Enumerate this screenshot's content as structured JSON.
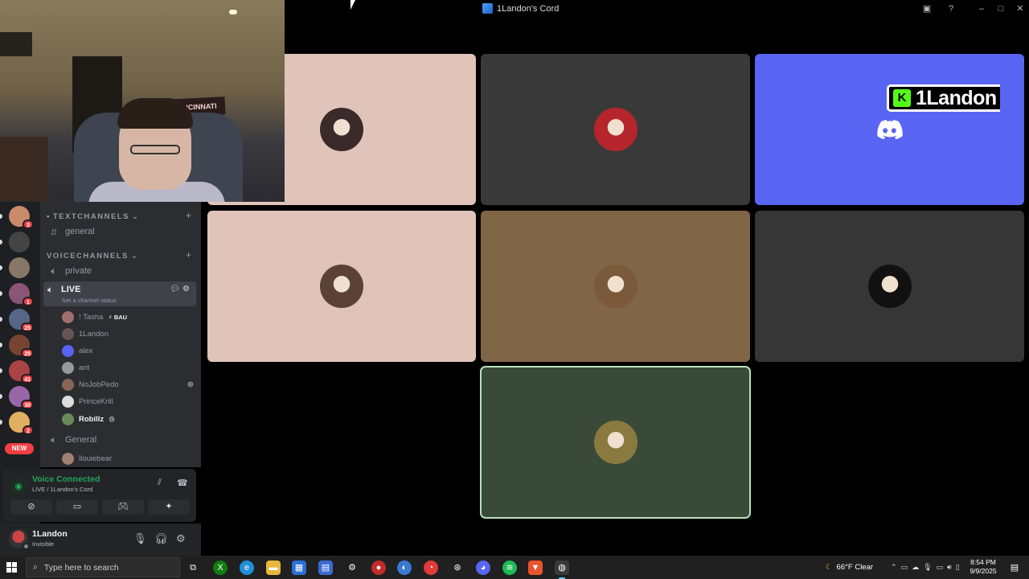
{
  "window": {
    "title": "1Landon's Cord",
    "controls": [
      "minimize",
      "maximize",
      "close"
    ]
  },
  "webcam": {
    "banner_text": "CINCINNATI"
  },
  "server_rail": {
    "servers": [
      {
        "badge": "3",
        "color": "#c98b6a"
      },
      {
        "badge": "",
        "color": "#444"
      },
      {
        "badge": "",
        "color": "#887766"
      },
      {
        "badge": "1",
        "color": "#8a5577"
      },
      {
        "badge": "25",
        "color": "#556688"
      },
      {
        "badge": "25",
        "color": "#774433"
      },
      {
        "badge": "41",
        "color": "#aa4444"
      },
      {
        "badge": "30",
        "color": "#9966aa"
      },
      {
        "badge": "2",
        "color": "#e0b060"
      }
    ],
    "new_label": "NEW"
  },
  "sidebar": {
    "text_category": "TEXTCHANNELS",
    "voice_category": "VOICECHANNELS",
    "text_channels": [
      {
        "name": "general"
      }
    ],
    "voice_channels": [
      {
        "name": "private"
      },
      {
        "name": "LIVE",
        "status": "Set a channel status"
      },
      {
        "name": "General"
      }
    ],
    "live_users": [
      {
        "name": "! Tasha",
        "tag": "⚡ BAU",
        "color": "#a07070"
      },
      {
        "name": "1Landon",
        "tag": "",
        "color": "#665555"
      },
      {
        "name": "alex",
        "tag": "",
        "color": "#5865f2"
      },
      {
        "name": "ant",
        "tag": "",
        "color": "#999"
      },
      {
        "name": "NoJobPedo",
        "tag": "",
        "color": "#886655"
      },
      {
        "name": "PrinceKrill",
        "tag": "",
        "color": "#ddd"
      },
      {
        "name": "Robillz",
        "tag": "😢",
        "color": "#6a8a5a"
      }
    ],
    "general_users": [
      {
        "name": "llouiebear",
        "color": "#a08070"
      }
    ]
  },
  "voice_panel": {
    "title": "Voice Connected",
    "subtitle": "LIVE / 1Landon's Cord"
  },
  "user_panel": {
    "name": "1Landon",
    "status": "Invisible"
  },
  "stream": {
    "streamer_name": "1Landon",
    "k_letter": "K"
  },
  "video_tiles": [
    {
      "bg": "#e0c4ba",
      "avatar": "#3a2a2a"
    },
    {
      "bg": "#3a3939",
      "avatar": "#b5252b"
    },
    {
      "bg": "#5865f2",
      "avatar": ""
    },
    {
      "bg": "#e0c4ba",
      "avatar": "#5a4238"
    },
    {
      "bg": "#806547",
      "avatar": "#7a5a3a"
    },
    {
      "bg": "#363636",
      "avatar": "#111"
    },
    {
      "bg": "#3a4a38",
      "avatar": "#8a7a40"
    }
  ],
  "taskbar": {
    "search_placeholder": "Type here to search",
    "weather": "66°F  Clear",
    "time": "8:54 PM",
    "date": "9/9/2025"
  }
}
